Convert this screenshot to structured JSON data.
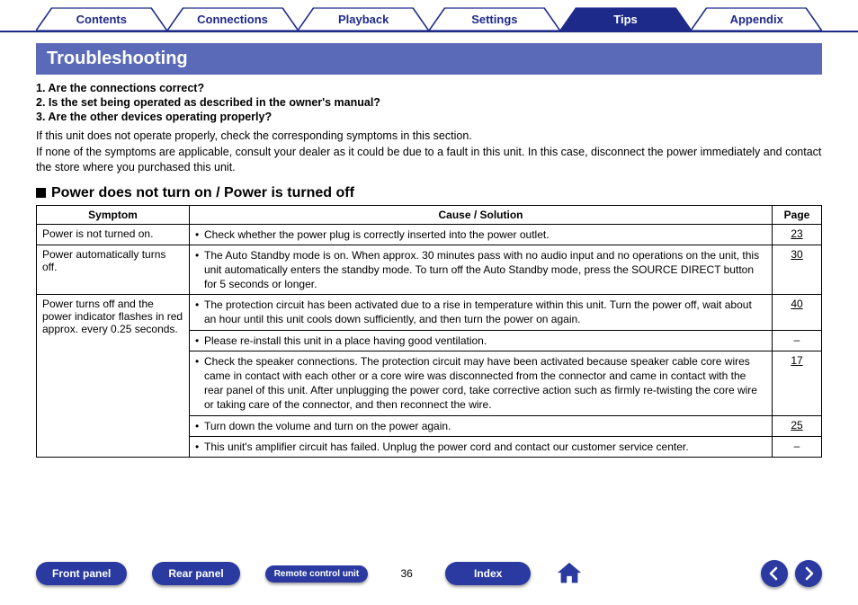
{
  "tabs": {
    "contents": "Contents",
    "connections": "Connections",
    "playback": "Playback",
    "settings": "Settings",
    "tips": "Tips",
    "appendix": "Appendix"
  },
  "section_title": "Troubleshooting",
  "checklist": {
    "q1": "1.  Are the connections correct?",
    "q2": "2.  Is the set being operated as described in the owner's manual?",
    "q3": "3.  Are the other devices operating properly?"
  },
  "intro": {
    "p1": "If this unit does not operate properly, check the corresponding symptoms in this section.",
    "p2": "If none of the symptoms are applicable, consult your dealer as it could be due to a fault in this unit. In this case, disconnect the power immediately and contact the store where you purchased this unit."
  },
  "subheading": "Power does not turn on / Power is turned off",
  "table": {
    "headers": {
      "symptom": "Symptom",
      "cause": "Cause / Solution",
      "page": "Page"
    },
    "rows": [
      {
        "symptom": "Power is not turned on.",
        "cause": "Check whether the power plug is correctly inserted into the power outlet.",
        "page": "23"
      },
      {
        "symptom": "Power automatically turns off.",
        "cause": "The Auto Standby mode is on. When approx. 30 minutes pass with no audio input and no operations on the unit, this unit automatically enters the standby mode. To turn off the Auto Standby mode, press the SOURCE DIRECT button for 5 seconds or longer.",
        "page": "30"
      },
      {
        "symptom": "Power turns off and the power indicator flashes in red approx. every 0.25 seconds.",
        "cause": "The protection circuit has been activated due to a rise in temperature within this unit. Turn the power off, wait about an hour until this unit cools down sufficiently, and then turn the power on again.",
        "page": "40"
      },
      {
        "symptom": "",
        "cause": "Please re-install this unit in a place having good ventilation.",
        "page": "–"
      },
      {
        "symptom": "",
        "cause": "Check the speaker connections. The protection circuit may have been activated because speaker cable core wires came in contact with each other or a core wire was disconnected from the connector and came in contact with the rear panel of this unit. After unplugging the power cord, take corrective action such as firmly re-twisting the core wire or taking care of the connector, and then reconnect the wire.",
        "page": "17"
      },
      {
        "symptom": "",
        "cause": "Turn down the volume and turn on the power again.",
        "page": "25"
      },
      {
        "symptom": "",
        "cause": "This unit's amplifier circuit has failed. Unplug the power cord and contact our customer service center.",
        "page": "–"
      }
    ]
  },
  "footer": {
    "front_panel": "Front panel",
    "rear_panel": "Rear panel",
    "remote": "Remote control unit",
    "page_number": "36",
    "index": "Index"
  }
}
